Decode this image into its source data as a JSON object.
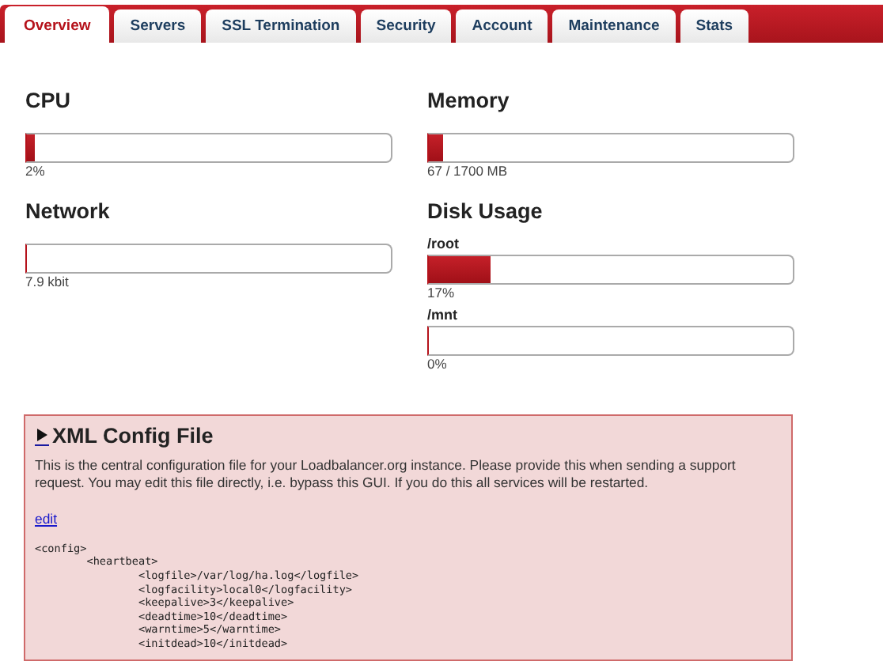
{
  "tabs": [
    {
      "label": "Overview",
      "selected": true
    },
    {
      "label": "Servers",
      "selected": false
    },
    {
      "label": "SSL Termination",
      "selected": false
    },
    {
      "label": "Security",
      "selected": false
    },
    {
      "label": "Account",
      "selected": false
    },
    {
      "label": "Maintenance",
      "selected": false
    },
    {
      "label": "Stats",
      "selected": false
    }
  ],
  "stats": [
    {
      "title": "CPU",
      "meters": [
        {
          "level": 0.02,
          "reading": "2%"
        }
      ]
    },
    {
      "title": "Memory",
      "meters": [
        {
          "level": 0.04,
          "reading": "67 / 1700 MB"
        }
      ]
    },
    {
      "title": "Network",
      "meters": [
        {
          "level": 0,
          "reading": "7.9 kbit"
        }
      ]
    },
    {
      "title": "Disk Usage",
      "meters": [
        {
          "label": "/root",
          "level": 0.17,
          "reading": "17%"
        },
        {
          "label": "/mnt",
          "level": 0,
          "reading": "0%"
        }
      ]
    }
  ],
  "config": {
    "title": "XML Config File",
    "expanded": false,
    "description": "This is the central configuration file for your Loadbalancer.org instance. Please provide this when sending a support request. You may edit this file directly, i.e. bypass this GUI. If you do this all services will be restarted.",
    "link": "edit",
    "code": [
      "<config>",
      "\t<heartbeat>",
      "\t\t<logfile>/var/log/ha.log</logfile>",
      "\t\t<logfacility>local0</logfacility>",
      "\t\t<keepalive>3</keepalive>",
      "\t\t<deadtime>10</deadtime>",
      "\t\t<warntime>5</warntime>",
      "\t\t<initdead>10</initdead>"
    ]
  }
}
